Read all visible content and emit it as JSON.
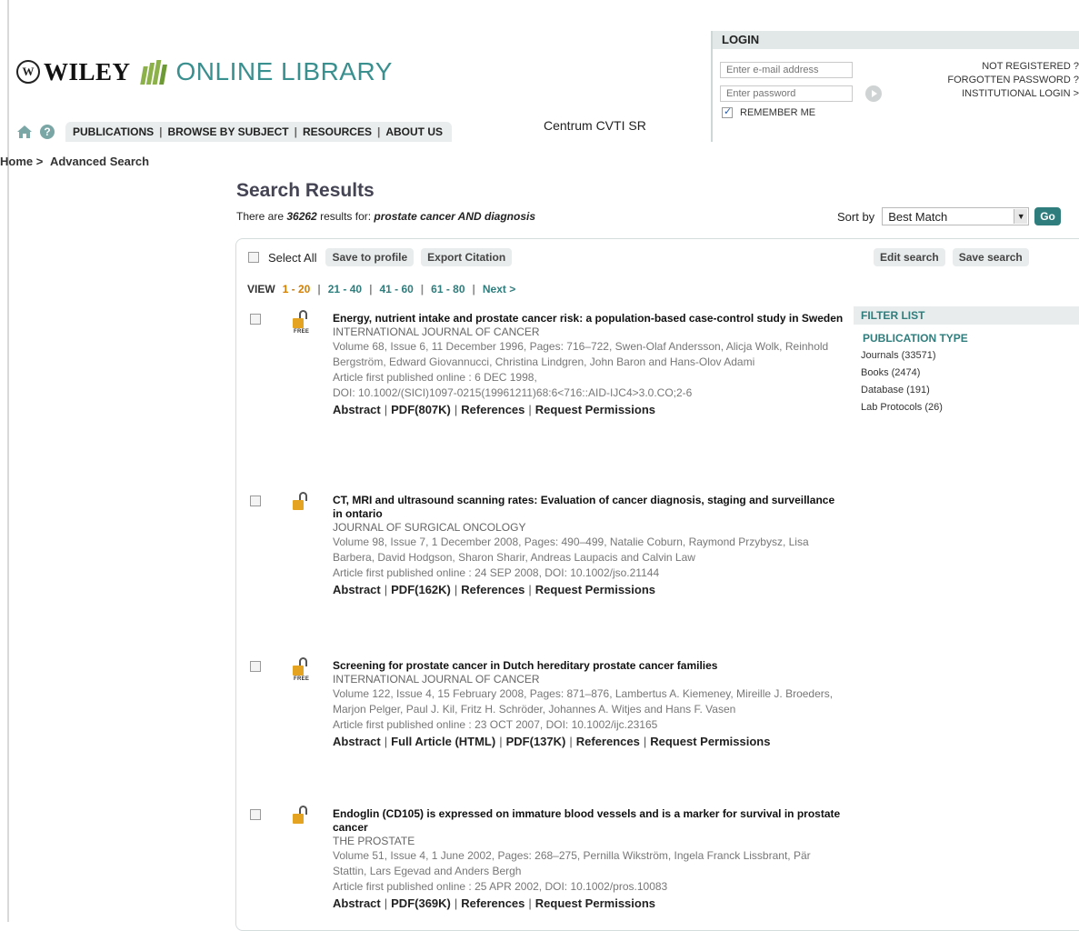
{
  "brand": {
    "wiley": "WILEY",
    "library": "ONLINE LIBRARY"
  },
  "nav": {
    "tabs": [
      "PUBLICATIONS",
      "BROWSE BY SUBJECT",
      "RESOURCES",
      "ABOUT US"
    ],
    "institution": "Centrum CVTI SR"
  },
  "login": {
    "title": "LOGIN",
    "email_placeholder": "Enter e-mail address",
    "password_placeholder": "Enter password",
    "remember": "REMEMBER ME",
    "not_registered": "NOT REGISTERED ?",
    "forgotten": "FORGOTTEN PASSWORD ?",
    "institutional": "INSTITUTIONAL LOGIN >"
  },
  "breadcrumb": {
    "home": "Home >",
    "current": "Advanced Search"
  },
  "results": {
    "heading": "Search Results",
    "prefix": "There are ",
    "count": "36262",
    "mid": " results for: ",
    "query": "prostate cancer AND diagnosis"
  },
  "sort": {
    "label": "Sort by",
    "value": "Best Match",
    "go": "Go"
  },
  "toolbar": {
    "select_all": "Select All",
    "save_profile": "Save to profile",
    "export": "Export Citation",
    "edit": "Edit search",
    "save_search": "Save search"
  },
  "view": {
    "label": "VIEW",
    "pages": [
      "1 - 20",
      "21 - 40",
      "41 - 60",
      "61 - 80"
    ],
    "next": "Next >"
  },
  "filter": {
    "title": "FILTER LIST",
    "type_title": "PUBLICATION TYPE",
    "items": [
      "Journals (33571)",
      "Books (2474)",
      "Database (191)",
      "Lab Protocols (26)"
    ]
  },
  "items": [
    {
      "title": "Energy, nutrient intake and prostate cancer risk: a population-based case-control study in Sweden",
      "journal": "INTERNATIONAL JOURNAL OF CANCER",
      "meta": "Volume 68, Issue 6, 11 December 1996, Pages: 716–722, Swen-Olaf Andersson, Alicja Wolk, Reinhold Bergström, Edward Giovannucci, Christina Lindgren, John Baron and Hans-Olov Adami",
      "published": "Article first published online : 6 DEC 1998,",
      "doi": "DOI: 10.1002/(SICI)1097-0215(19961211)68:6<716::AID-IJC4>3.0.CO;2-6",
      "free": "FREE",
      "actions": [
        "Abstract",
        "PDF(807K)",
        "References",
        "Request Permissions"
      ]
    },
    {
      "title": "CT, MRI and ultrasound scanning rates: Evaluation of cancer diagnosis, staging and surveillance in ontario",
      "journal": "JOURNAL OF SURGICAL ONCOLOGY",
      "meta": "Volume 98, Issue 7, 1 December 2008, Pages: 490–499, Natalie Coburn, Raymond Przybysz, Lisa Barbera, David Hodgson, Sharon Sharir, Andreas Laupacis and Calvin Law",
      "published": "Article first published online : 24 SEP 2008, DOI: 10.1002/jso.21144",
      "doi": "",
      "free": "",
      "actions": [
        "Abstract",
        "PDF(162K)",
        "References",
        "Request Permissions"
      ]
    },
    {
      "title": "Screening for prostate cancer in Dutch hereditary prostate cancer families",
      "journal": "INTERNATIONAL JOURNAL OF CANCER",
      "meta": "Volume 122, Issue 4, 15 February 2008, Pages: 871–876, Lambertus A. Kiemeney, Mireille J. Broeders, Marjon Pelger, Paul J. Kil, Fritz H. Schröder, Johannes A. Witjes and Hans F. Vasen",
      "published": "Article first published online : 23 OCT 2007, DOI: 10.1002/ijc.23165",
      "doi": "",
      "free": "FREE",
      "actions": [
        "Abstract",
        "Full Article (HTML)",
        "PDF(137K)",
        "References",
        "Request Permissions"
      ]
    },
    {
      "title": "Endoglin (CD105) is expressed on immature blood vessels and is a marker for survival in prostate cancer",
      "journal": "THE PROSTATE",
      "meta": "Volume 51, Issue 4, 1 June 2002, Pages: 268–275, Pernilla Wikström, Ingela Franck Lissbrant, Pär Stattin, Lars Egevad and Anders Bergh",
      "published": "Article first published online : 25 APR 2002, DOI: 10.1002/pros.10083",
      "doi": "",
      "free": "",
      "actions": [
        "Abstract",
        "PDF(369K)",
        "References",
        "Request Permissions"
      ]
    }
  ]
}
